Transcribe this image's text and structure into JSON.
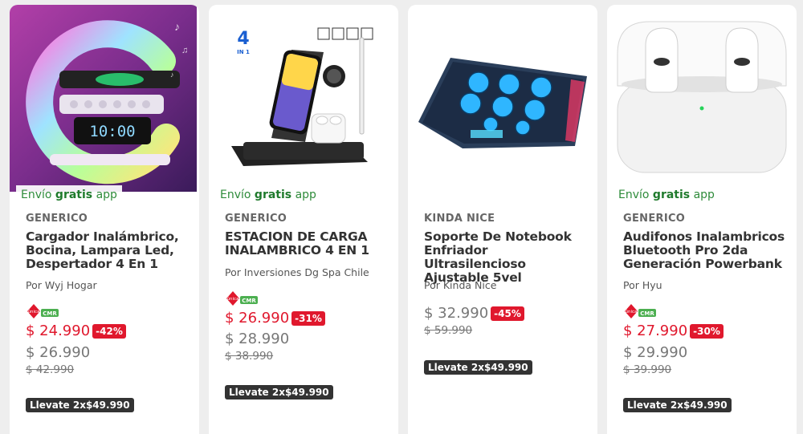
{
  "colors": {
    "sale_red": "#e0182d",
    "shipping_green": "#2e8b3a",
    "promo_dark": "#333333"
  },
  "products": [
    {
      "image_icon": "g-lamp-speaker-charger-image",
      "shipping": {
        "prefix": "Envío ",
        "bold": "gratis",
        "suffix": " app"
      },
      "brand": "GENERICO",
      "title": "Cargador Inalámbrico, Bocina, Lampara Led, Despertador 4 En 1",
      "seller": "Por Wyj Hogar",
      "cmr": {
        "unica": "única",
        "cmr": "CMR"
      },
      "price_card": "$ 24.990",
      "discount": "-42%",
      "price_normal": "$ 26.990",
      "price_old": "$ 42.990",
      "promo": "Llevate 2x$49.990"
    },
    {
      "image_icon": "charging-station-image",
      "image_label": "4",
      "image_sublabel": "IN 1",
      "shipping": {
        "prefix": "Envío ",
        "bold": "gratis",
        "suffix": " app"
      },
      "brand": "GENERICO",
      "title": "ESTACION DE CARGA INALAMBRICO 4 EN 1",
      "seller": "Por Inversiones Dg Spa Chile",
      "cmr": {
        "unica": "única",
        "cmr": "CMR"
      },
      "price_card": "$ 26.990",
      "discount": "-31%",
      "price_normal": "$ 28.990",
      "price_old": "$ 38.990",
      "promo": "Llevate 2x$49.990"
    },
    {
      "image_icon": "laptop-cooler-image",
      "brand": "KINDA NICE",
      "title": "Soporte De Notebook Enfriador Ultrasilencioso Ajustable 5vel",
      "seller": "Por Kinda Nice",
      "price_card": "$ 32.990",
      "discount": "-45%",
      "price_old": "$ 59.990",
      "promo": "Llevate 2x$49.990"
    },
    {
      "image_icon": "earbuds-case-image",
      "shipping": {
        "prefix": "Envío ",
        "bold": "gratis",
        "suffix": " app"
      },
      "brand": "GENERICO",
      "title": "Audifonos Inalambricos Bluetooth Pro 2da Generación Powerbank",
      "seller": "Por Hyu",
      "cmr": {
        "unica": "única",
        "cmr": "CMR"
      },
      "price_card": "$ 27.990",
      "discount": "-30%",
      "price_normal": "$ 29.990",
      "price_old": "$ 39.990",
      "promo": "Llevate 2x$49.990"
    }
  ]
}
